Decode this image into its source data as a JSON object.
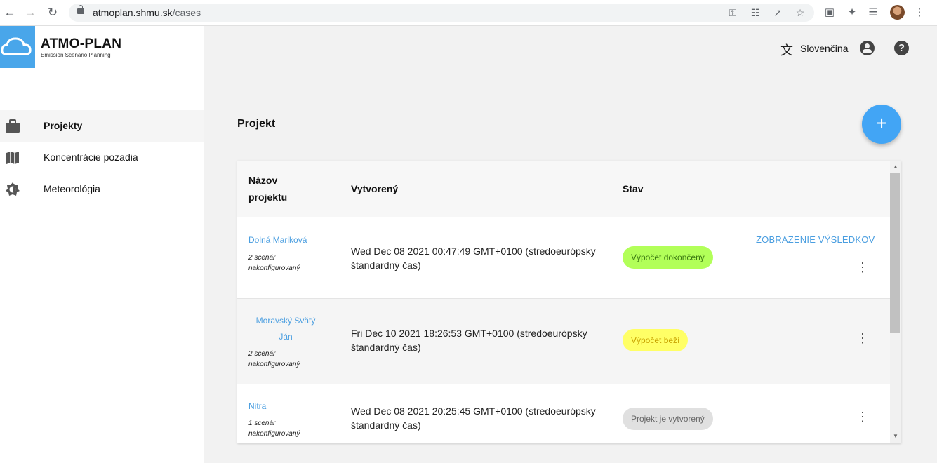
{
  "browser": {
    "url_host": "atmoplan.shmu.sk",
    "url_path": "/cases"
  },
  "app": {
    "title": "ATMO-PLAN",
    "subtitle": "Emission Scenario Planning"
  },
  "sidebar": {
    "items": [
      {
        "label": "Projekty",
        "icon": "briefcase-icon",
        "active": true
      },
      {
        "label": "Koncentrácie pozadia",
        "icon": "map-icon",
        "active": false
      },
      {
        "label": "Meteorológia",
        "icon": "brightness-icon",
        "active": false
      }
    ]
  },
  "topbar": {
    "language": "Slovenčina"
  },
  "main": {
    "title": "Projekt",
    "fab_symbol": "+"
  },
  "table": {
    "headers": {
      "name_line1": "Názov",
      "name_line2": "projektu",
      "created": "Vytvorený",
      "status": "Stav"
    },
    "rows": [
      {
        "name": "Dolná Mariková",
        "scenarios": "2 scenár",
        "configured": "nakonfigurovaný",
        "created_line1": "Wed Dec 08 2021 00:47:49 GMT+0100 (stredoeurópsky",
        "created_line2": "štandardný čas)",
        "status": "Výpočet dokončený",
        "action": "ZOBRAZENIE VÝSLEDKOV"
      },
      {
        "name_line1": "Moravský Svätý",
        "name_line2": "Ján",
        "scenarios": "2 scenár",
        "configured": "nakonfigurovaný",
        "created_line1": "Fri Dec 10 2021 18:26:53 GMT+0100 (stredoeurópsky",
        "created_line2": "štandardný čas)",
        "status": "Výpočet beží"
      },
      {
        "name": "Nitra",
        "scenarios": "1 scenár",
        "configured": "nakonfigurovaný",
        "created_line1": "Wed Dec 08 2021 20:25:45 GMT+0100 (stredoeurópsky",
        "created_line2": "štandardný čas)",
        "status": "Projekt je vytvorený"
      }
    ]
  },
  "colors": {
    "accent": "#42a5f5",
    "logo_bg": "#49a6ea",
    "status_done": "#b2ff59",
    "status_running": "#ffff66",
    "status_created": "#e0e0e0"
  }
}
